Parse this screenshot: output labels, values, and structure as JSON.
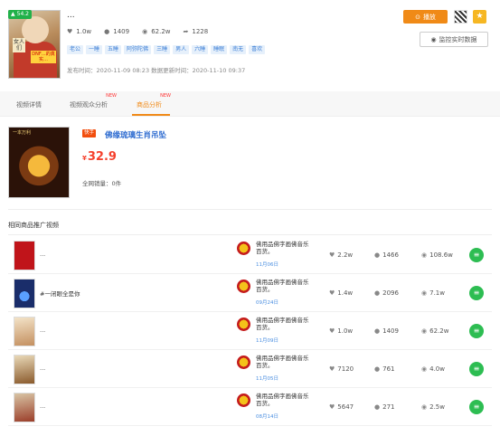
{
  "header": {
    "score": "54.2",
    "title": "...",
    "thumb_text": {
      "left": "女人们",
      "right": "DNF…的真实…"
    },
    "stats": {
      "likes": "1.0w",
      "comments": "1409",
      "views": "62.2w",
      "shares": "1228"
    },
    "tags": [
      "老公",
      "一睡",
      "五睡",
      "阿弥陀佛",
      "三睡",
      "男人",
      "六睡",
      "睡眠",
      "南无",
      "喜欢"
    ],
    "times": "发布时间：2020-11-09 08:23 数据更新时间：2020-11-10 09:37",
    "play_label": "播放",
    "monitor_label": "监控实时数据"
  },
  "tabs": [
    {
      "label": "视频详情",
      "new": ""
    },
    {
      "label": "视频观众分析",
      "new": "NEW"
    },
    {
      "label": "商品分析",
      "new": "NEW"
    }
  ],
  "product": {
    "badge": "快手",
    "title": "佛缘琉璃生肖吊坠",
    "currency": "¥",
    "price": "32.9",
    "sales": "全网销量：0件",
    "image_text": "一本万利"
  },
  "section_title": "相同商品推广视频",
  "videos": [
    {
      "title": "...",
      "user": "佛用品佛字画佛音乐百货。",
      "date": "11月06日",
      "likes": "2.2w",
      "comments": "1466",
      "views": "108.6w"
    },
    {
      "title": "#一闭眼全是你",
      "user": "佛用品佛字画佛音乐百货。",
      "date": "09月24日",
      "likes": "1.4w",
      "comments": "2096",
      "views": "7.1w"
    },
    {
      "title": "...",
      "user": "佛用品佛字画佛音乐百货。",
      "date": "11月09日",
      "likes": "1.0w",
      "comments": "1409",
      "views": "62.2w"
    },
    {
      "title": "...",
      "user": "佛用品佛字画佛音乐百货。",
      "date": "11月05日",
      "likes": "7120",
      "comments": "761",
      "views": "4.0w"
    },
    {
      "title": "...",
      "user": "佛用品佛字画佛音乐百货。",
      "date": "08月14日",
      "likes": "5647",
      "comments": "271",
      "views": "2.5w"
    }
  ],
  "colors": {
    "accent": "#f08a17",
    "link": "#2d6bd0",
    "price": "#f5412d",
    "tag_bg": "#e6f0fb",
    "go": "#2dbd52"
  },
  "icons": [
    "like-icon",
    "comment-icon",
    "view-icon",
    "share-icon",
    "play-icon",
    "qr-icon",
    "star-icon",
    "eye-icon",
    "list-icon"
  ]
}
